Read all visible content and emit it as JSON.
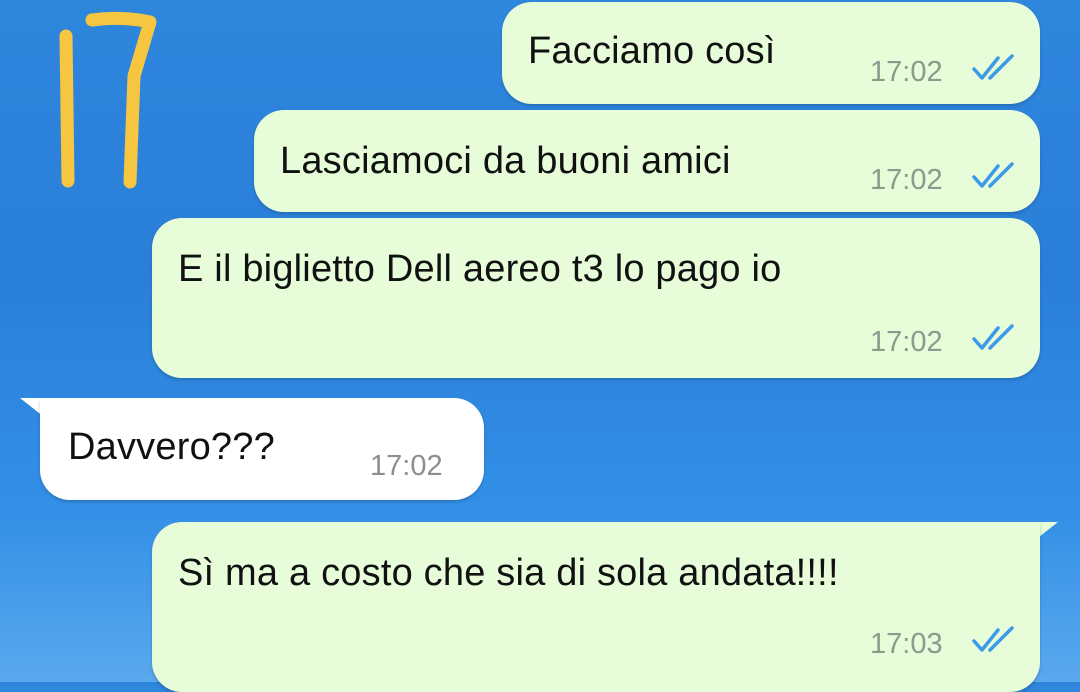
{
  "annotation": {
    "text": "17"
  },
  "messages": [
    {
      "direction": "out",
      "text": "Facciamo così",
      "time": "17:02",
      "status": "read",
      "status_icon": "double-check-icon"
    },
    {
      "direction": "out",
      "text": "Lasciamoci da buoni amici",
      "time": "17:02",
      "status": "read",
      "status_icon": "double-check-icon"
    },
    {
      "direction": "out",
      "text": "E il biglietto Dell aereo t3 lo pago io",
      "time": "17:02",
      "status": "read",
      "status_icon": "double-check-icon"
    },
    {
      "direction": "in",
      "text": "Davvero???",
      "time": "17:02"
    },
    {
      "direction": "out",
      "text": "Sì ma a costo che sia di sola andata!!!!",
      "time": "17:03",
      "status": "read",
      "status_icon": "double-check-icon"
    }
  ],
  "colors": {
    "background": "#2f86dd",
    "outgoing_bubble": "#e7fcd8",
    "incoming_bubble": "#ffffff",
    "read_ticks": "#3c9be8",
    "annotation": "#f6c640"
  }
}
